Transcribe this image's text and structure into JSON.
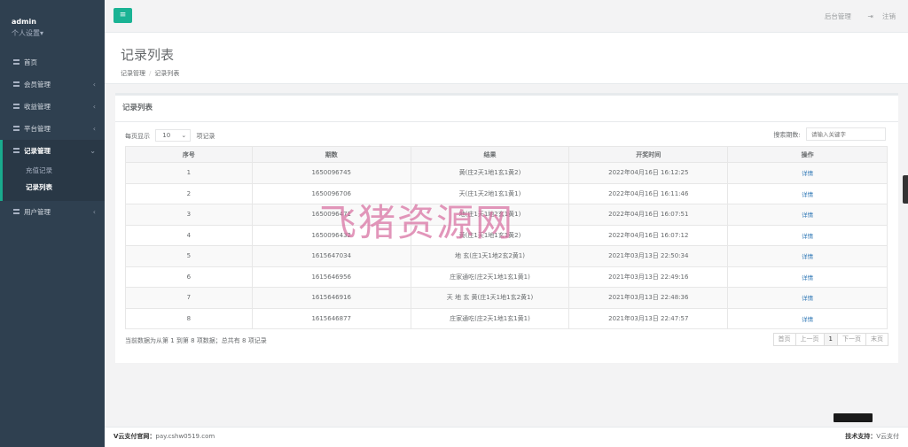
{
  "profile": {
    "name": "admin",
    "settings": "个人设置"
  },
  "sidebar": {
    "items": [
      {
        "label": "首页",
        "chevron": ""
      },
      {
        "label": "会员管理",
        "chevron": "‹"
      },
      {
        "label": "收益管理",
        "chevron": "‹"
      },
      {
        "label": "平台管理",
        "chevron": "‹"
      },
      {
        "label": "记录管理",
        "chevron": "⌄"
      },
      {
        "label": "用户管理",
        "chevron": "‹"
      }
    ],
    "sub_items": [
      "充值记录",
      "记录列表"
    ]
  },
  "topbar": {
    "menu_icon": "menu-icon",
    "admin_link": "后台管理",
    "logout_label": "注销"
  },
  "heading": {
    "title": "记录列表",
    "crumb_parent": "记录管理",
    "crumb_current": "记录列表"
  },
  "panel": {
    "title": "记录列表",
    "length_prefix": "每页显示",
    "length_value": "10",
    "length_suffix": "项记录",
    "search_label": "搜索期数:",
    "search_placeholder": "请输入关键字"
  },
  "table": {
    "headers": [
      "序号",
      "期数",
      "结果",
      "开奖时间",
      "操作"
    ],
    "rows": [
      [
        "1",
        "1650096745",
        "黄(庄2天1地1玄1黄2)",
        "2022年04月16日 16:12:25",
        "详情"
      ],
      [
        "2",
        "1650096706",
        "天(庄1天2地1玄1黄1)",
        "2022年04月16日 16:11:46",
        "详情"
      ],
      [
        "3",
        "1650096471",
        "地(庄1天1地2玄1黄1)",
        "2022年04月16日 16:07:51",
        "详情"
      ],
      [
        "4",
        "1650096432",
        "黄(庄1天1地1玄1黄2)",
        "2022年04月16日 16:07:12",
        "详情"
      ],
      [
        "5",
        "1615647034",
        "地 玄(庄1天1地2玄2黄1)",
        "2021年03月13日 22:50:34",
        "详情"
      ],
      [
        "6",
        "1615646956",
        "庄家通吃(庄2天1地1玄1黄1)",
        "2021年03月13日 22:49:16",
        "详情"
      ],
      [
        "7",
        "1615646916",
        "天 地 玄 黄(庄1天1地1玄2黄1)",
        "2021年03月13日 22:48:36",
        "详情"
      ],
      [
        "8",
        "1615646877",
        "庄家通吃(庄2天1地1玄1黄1)",
        "2021年03月13日 22:47:57",
        "详情"
      ]
    ]
  },
  "info": "当前数据为从第 1 到第 8 项数据；总共有 8 项记录",
  "pager": {
    "first": "首页",
    "prev": "上一页",
    "current": "1",
    "next": "下一页",
    "last": "末页"
  },
  "watermark": "飞猪资源网",
  "footer": {
    "left_label": "V云支付官网：",
    "left_url": "pay.cshw0519.com",
    "right_label": "技术支持：",
    "right_value": "V云支付"
  }
}
